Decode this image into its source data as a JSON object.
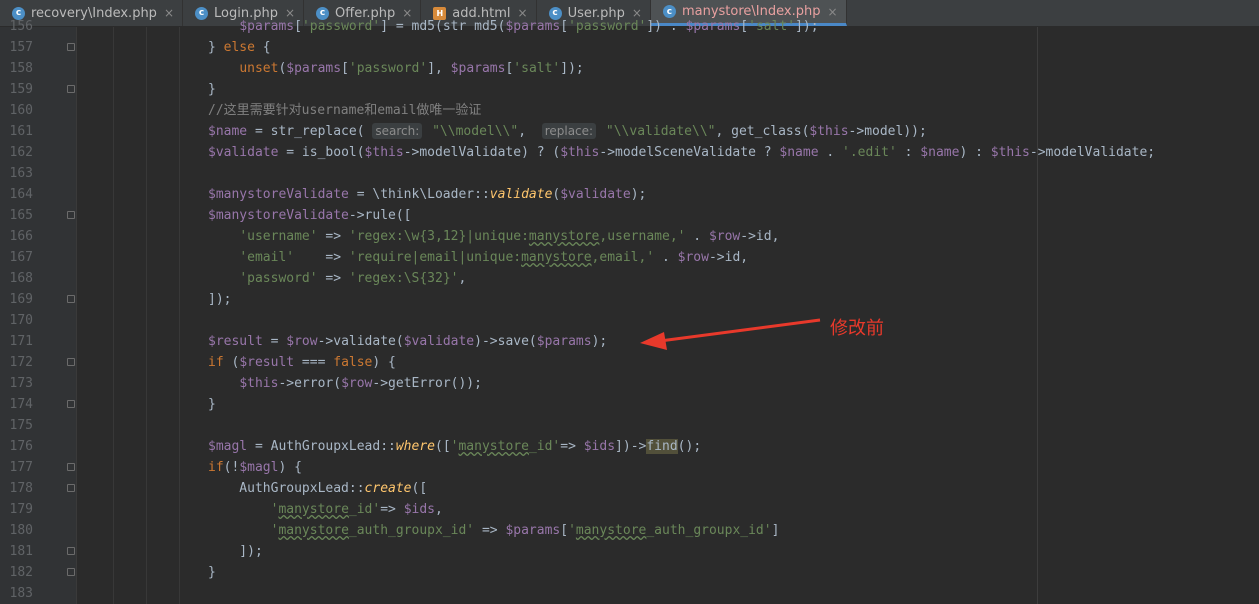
{
  "tabs": [
    {
      "label": "recovery\\Index.php",
      "type": "php",
      "active": false
    },
    {
      "label": "Login.php",
      "type": "php",
      "active": false
    },
    {
      "label": "Offer.php",
      "type": "php",
      "active": false
    },
    {
      "label": "add.html",
      "type": "html",
      "active": false
    },
    {
      "label": "User.php",
      "type": "php",
      "active": false
    },
    {
      "label": "manystore\\Index.php",
      "type": "php",
      "active": true
    }
  ],
  "tab_close_glyph": "×",
  "php_icon_glyph": "c",
  "html_icon_glyph": "H",
  "colors": {
    "accent": "#4a88c7",
    "annotation": "#e8392b"
  },
  "editor": {
    "line_numbers": [
      "156",
      "157",
      "158",
      "159",
      "160",
      "161",
      "162",
      "163",
      "164",
      "165",
      "166",
      "167",
      "168",
      "169",
      "170",
      "171",
      "172",
      "173",
      "174",
      "175",
      "176",
      "177",
      "178",
      "179",
      "180",
      "181",
      "182",
      "183"
    ],
    "folded_lines": [
      "157",
      "159",
      "165",
      "169",
      "172",
      "174",
      "177",
      "178",
      "181",
      "182"
    ],
    "lines": [
      "    $params['password'] = md5(str md5($params['password']) . $params['salt']);",
      "} else {",
      "    unset($params['password'], $params['salt']);",
      "}",
      "//这里需要针对username和email做唯一验证",
      "$name = str_replace( search: \"\\\\model\\\\\",  replace: \"\\\\validate\\\\\", get_class($this->model));",
      "$validate = is_bool($this->modelValidate) ? ($this->modelSceneValidate ? $name . '.edit' : $name) : $this->modelValidate;",
      "",
      "$manystoreValidate = \\think\\Loader::validate($validate);",
      "$manystoreValidate->rule([",
      "    'username' => 'regex:\\w{3,12}|unique:manystore,username,' . $row->id,",
      "    'email'    => 'require|email|unique:manystore,email,' . $row->id,",
      "    'password' => 'regex:\\S{32}',",
      "]);",
      "",
      "$result = $row->validate($validate)->save($params);",
      "if ($result === false) {",
      "    $this->error($row->getError());",
      "}",
      "",
      "$magl = AuthGroupxLead::where(['manystore_id'=> $ids])->find();",
      "if(!$magl) {",
      "    AuthGroupxLead::create([",
      "        'manystore_id'=> $ids,",
      "        'manystore_auth_groupx_id' => $params['manystore_auth_groupx_id']",
      "    ]);",
      "}",
      ""
    ],
    "inlay_hints": {
      "search": "search:",
      "replace": "replace:"
    }
  },
  "annotation": {
    "text": "修改前",
    "points_to_line": "171"
  }
}
